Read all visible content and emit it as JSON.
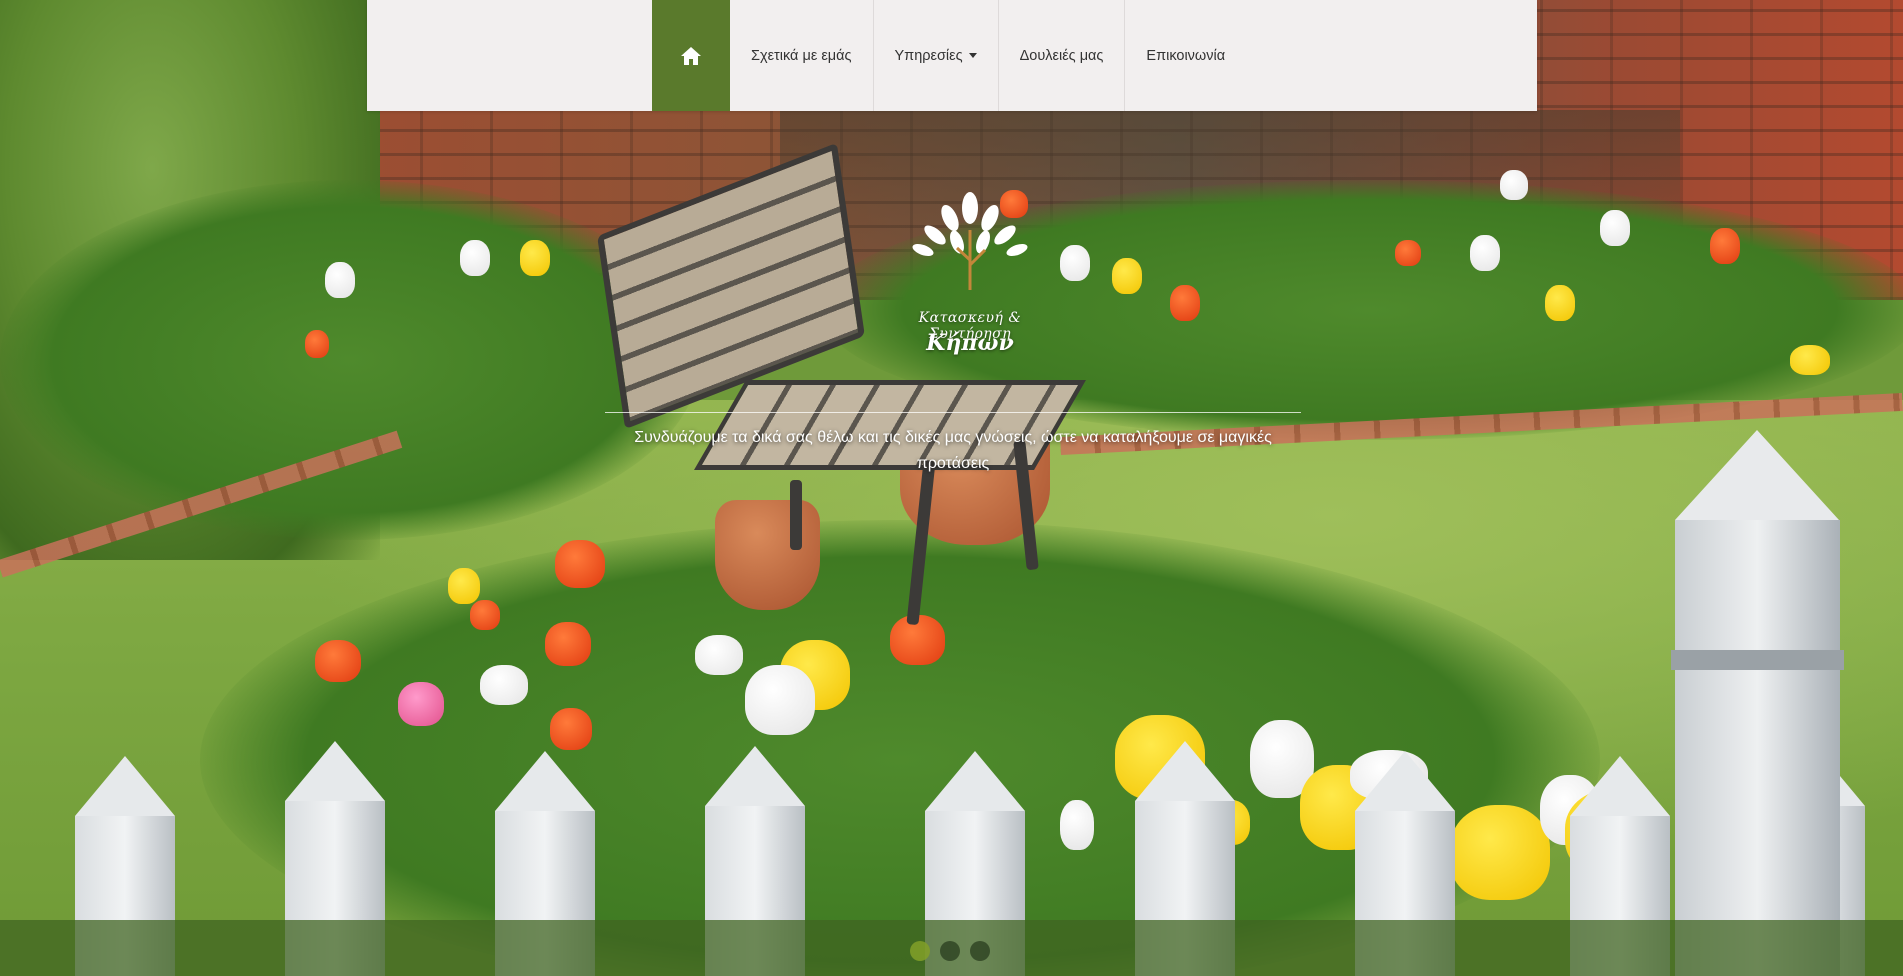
{
  "nav": {
    "home_icon": "home-icon",
    "items": [
      {
        "label": "Σχετικά με εμάς"
      },
      {
        "label": "Υπηρεσίες",
        "has_dropdown": true
      },
      {
        "label": "Δουλειές μας"
      },
      {
        "label": "Επικοινωνία"
      }
    ],
    "active_color": "#5a7a2c",
    "background_color": "#f2efef"
  },
  "hero": {
    "logo_icon": "leaves-logo-icon",
    "logo_subtitle": "Κατασκευή & Συντήρηση",
    "logo_title": "Κήπων",
    "tagline": "Συνδυάζουμε τα δικά σας θέλω και τις δικές μας γνώσεις, ώστε να καταλήξουμε σε μαγικές προτάσεις"
  },
  "carousel": {
    "slide_count": 3,
    "active_index": 0
  }
}
